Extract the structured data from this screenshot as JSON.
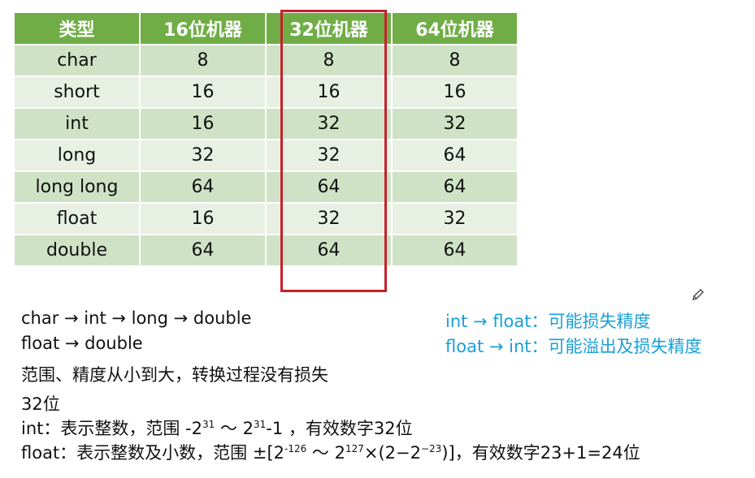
{
  "table": {
    "headers": [
      "类型",
      "16位机器",
      "32位机器",
      "64位机器"
    ],
    "rows": [
      [
        "char",
        "8",
        "8",
        "8"
      ],
      [
        "short",
        "16",
        "16",
        "16"
      ],
      [
        "int",
        "16",
        "32",
        "32"
      ],
      [
        "long",
        "32",
        "32",
        "64"
      ],
      [
        "long long",
        "64",
        "64",
        "64"
      ],
      [
        "float",
        "16",
        "32",
        "32"
      ],
      [
        "double",
        "64",
        "64",
        "64"
      ]
    ]
  },
  "notes_left": {
    "chain1": "char → int → long → double",
    "chain2": "float → double",
    "summary": "范围、精度从小到大，转换过程没有损失",
    "bits32": "32位",
    "int_prefix": "int：表示整数，范围 -2",
    "int_exp1": "31",
    "int_mid": " ～ 2",
    "int_exp2": "31",
    "int_suffix": "-1 ，有效数字32位",
    "float_prefix": "float：表示整数及小数，范围 ±[2",
    "float_exp1": "-126",
    "float_mid": " ～ 2",
    "float_exp2": "127",
    "float_mid2": "×(2−2",
    "float_exp3": "−23",
    "float_suffix": ")]，有效数字23+1=24位"
  },
  "notes_right": {
    "line1": "int → float：可能损失精度",
    "line2": "float → int：可能溢出及损失精度"
  },
  "colors": {
    "header_bg": "#70ad47",
    "row_dark": "#cfe2c5",
    "row_light": "#e8f0e3",
    "highlight_border": "#c8202c",
    "note_blue": "#1aa0d8"
  },
  "icons": {
    "pencil": "pencil-icon"
  }
}
